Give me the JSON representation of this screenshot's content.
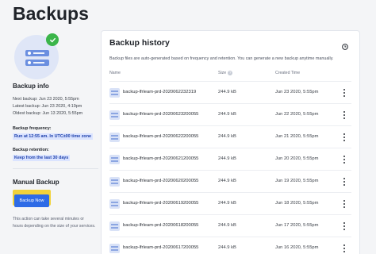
{
  "page": {
    "title": "Backups"
  },
  "sidebar": {
    "backup_info_title": "Backup info",
    "next_backup": "Next backup: Jun 23 2020, 5:55pm",
    "latest_backup": "Latest backup: Jun 23 2020, 4:19pm",
    "oldest_backup": "Oldest backup: Jun 13 2020, 5:55pm",
    "frequency_label": "Backup frequency:",
    "frequency_value": "Run at 12:55 am. In UTC±00 time zone",
    "retention_label": "Backup retention:",
    "retention_value": "Keep from the last 30 days",
    "manual_title": "Manual Backup",
    "button_label": "Backup Now",
    "note_line1": "This action can take several minutes or",
    "note_line2": "hours depending on the size of your services."
  },
  "history": {
    "title": "Backup history",
    "description": "Backup files are auto-generated based on frequency and retention. You can generate a new backup anytime manually.",
    "columns": {
      "name": "Name",
      "size": "Size",
      "created": "Created Time"
    },
    "rows": [
      {
        "name": "backup-lfrleam-prd-2020062232319",
        "size": "244.9 kB",
        "date": "Jun 23 2020, 5:55pm"
      },
      {
        "name": "backup-lfrleam-prd-20200623200055",
        "size": "244.9 kB",
        "date": "Jun 22 2020, 5:55pm"
      },
      {
        "name": "backup-lfrleam-prd-20200622200055",
        "size": "244.9 kB",
        "date": "Jun 21 2020, 5:55pm"
      },
      {
        "name": "backup-lfrleam-prd-20200621200055",
        "size": "244.9 kB",
        "date": "Jun 20 2020, 5:55pm"
      },
      {
        "name": "backup-lfrleam-prd-20200620200055",
        "size": "244.9 kB",
        "date": "Jun 19 2020, 5:55pm"
      },
      {
        "name": "backup-lfrleam-prd-20200619200055",
        "size": "244.9 kB",
        "date": "Jun 18 2020, 5:55pm"
      },
      {
        "name": "backup-lfrleam-prd-20200618200055",
        "size": "244.9 kB",
        "date": "Jun 17 2020, 5:55pm"
      },
      {
        "name": "backup-lfrleam-prd-20200617200055",
        "size": "244.9 kB",
        "date": "Jun 16 2020, 5:55pm"
      }
    ]
  },
  "icons": {
    "check": "check-icon",
    "clock": "clock-icon",
    "help": "help-icon",
    "file": "backup-file-icon",
    "more": "more-vertical-icon"
  },
  "colors": {
    "accent": "#2e6be6",
    "highlight_text": "#1c3faa",
    "highlight_bg": "#dbe4ff",
    "button_outline": "#f2d23a",
    "success": "#3bb54a"
  }
}
